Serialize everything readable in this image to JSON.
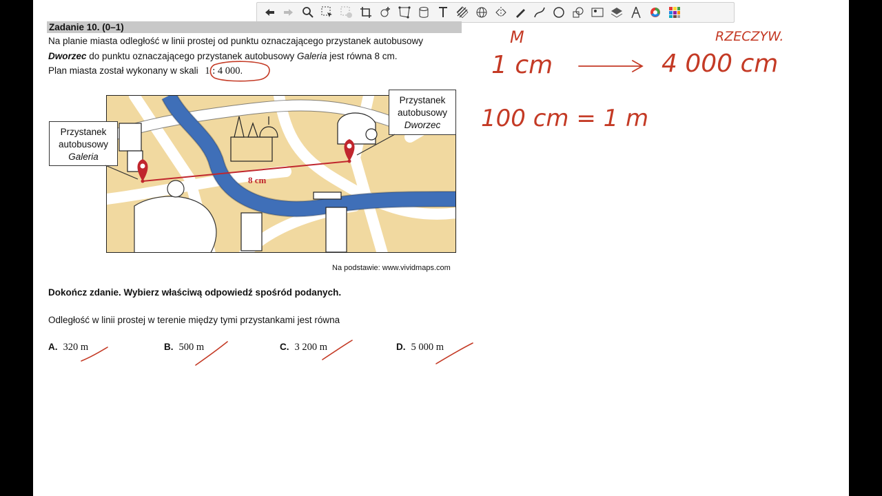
{
  "toolbar": {
    "tools": [
      {
        "icon": "undo-icon"
      },
      {
        "icon": "redo-icon"
      },
      {
        "icon": "zoom-icon"
      },
      {
        "icon": "select-icon"
      },
      {
        "icon": "erase-selection-icon"
      },
      {
        "icon": "crop-icon"
      },
      {
        "icon": "add-point-icon"
      },
      {
        "icon": "polygon-select-icon"
      },
      {
        "icon": "cylinder-icon"
      },
      {
        "icon": "text-icon"
      },
      {
        "icon": "hatch-icon"
      },
      {
        "icon": "sphere-grid-icon"
      },
      {
        "icon": "mirror-icon"
      },
      {
        "icon": "pen-icon"
      },
      {
        "icon": "curve-icon"
      },
      {
        "icon": "circle-icon"
      },
      {
        "icon": "shapes-icon"
      },
      {
        "icon": "image-icon"
      },
      {
        "icon": "layers-icon"
      },
      {
        "icon": "compass-icon"
      },
      {
        "icon": "color-wheel-icon"
      },
      {
        "icon": "palette-grid-icon"
      }
    ]
  },
  "task": {
    "title": "Zadanie 10. (0–1)",
    "line1": "Na planie miasta odległość w linii prostej od punktu oznaczającego przystanek autobusowy",
    "line2_italic": "Dworzec",
    "line2_rest": " do punktu oznaczającego przystanek autobusowy ",
    "line2_italic2": "Galeria",
    "line2_end": " jest równa  8 cm.",
    "line3": "Plan miasta został wykonany w skali",
    "scale": "1 : 4 000",
    "scale_dot": "."
  },
  "map": {
    "left_callout": {
      "line1": "Przystanek",
      "line2": "autobusowy",
      "line3": "Galeria"
    },
    "right_callout": {
      "line1": "Przystanek",
      "line2": "autobusowy",
      "line3": "Dworzec"
    },
    "distance_label": "8 cm",
    "source": "Na podstawie: www.vividmaps.com"
  },
  "instruction": "Dokończ zdanie. Wybierz właściwą odpowiedź spośród podanych.",
  "question": "Odległość w linii prostej w terenie między tymi przystankami jest równa",
  "answers": [
    {
      "letter": "A.",
      "value": "320 m"
    },
    {
      "letter": "B.",
      "value": "500 m"
    },
    {
      "letter": "C.",
      "value": "3 200 m"
    },
    {
      "letter": "D.",
      "value": "5 000 m"
    }
  ],
  "annotations": {
    "label_m": "M",
    "label_real": "RZECZYW.",
    "eq1_left": "1 cm",
    "eq1_right": "4 000 cm",
    "eq2": "100 cm = 1 m"
  },
  "colors": {
    "ink": "#c43a25",
    "water": "#3f6fb8",
    "land": "#f1d9a0",
    "road": "#ffffff"
  }
}
